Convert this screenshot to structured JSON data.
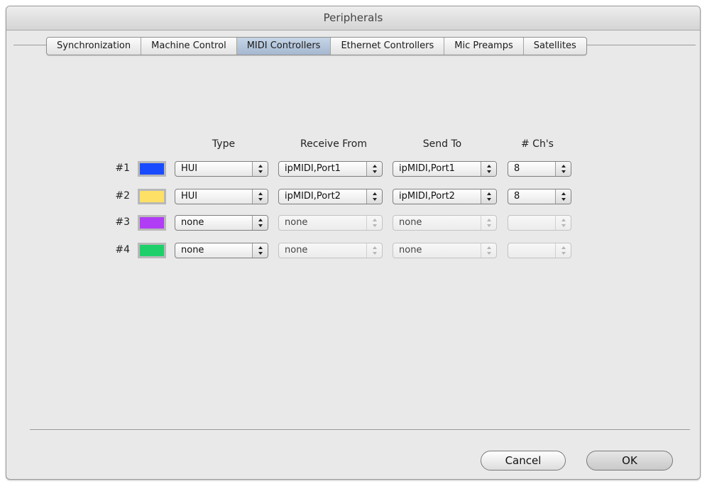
{
  "window": {
    "title": "Peripherals"
  },
  "tabs": [
    {
      "label": "Synchronization"
    },
    {
      "label": "Machine Control"
    },
    {
      "label": "MIDI Controllers",
      "active": true
    },
    {
      "label": "Ethernet Controllers"
    },
    {
      "label": "Mic Preamps"
    },
    {
      "label": "Satellites"
    }
  ],
  "columns": {
    "type": "Type",
    "receive_from": "Receive From",
    "send_to": "Send To",
    "channels": "# Ch's"
  },
  "controllers": [
    {
      "label": "#1",
      "color": "#1a4cff",
      "type": "HUI",
      "receive_from": "ipMIDI,Port1",
      "send_to": "ipMIDI,Port1",
      "channels": "8",
      "enabled": true
    },
    {
      "label": "#2",
      "color": "#ffe066",
      "type": "HUI",
      "receive_from": "ipMIDI,Port2",
      "send_to": "ipMIDI,Port2",
      "channels": "8",
      "enabled": true
    },
    {
      "label": "#3",
      "color": "#b13cf5",
      "type": "none",
      "receive_from": "none",
      "send_to": "none",
      "channels": "",
      "enabled": false
    },
    {
      "label": "#4",
      "color": "#1fd06a",
      "type": "none",
      "receive_from": "none",
      "send_to": "none",
      "channels": "",
      "enabled": false
    }
  ],
  "buttons": {
    "cancel": "Cancel",
    "ok": "OK"
  }
}
